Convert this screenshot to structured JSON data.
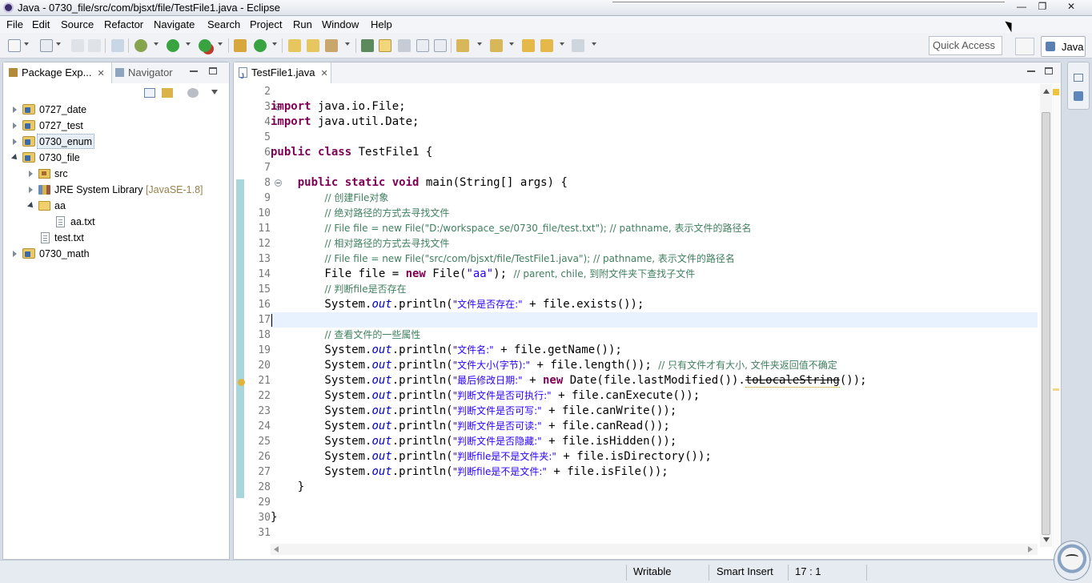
{
  "window": {
    "title": "Java - 0730_file/src/com/bjsxt/file/TestFile1.java - Eclipse",
    "controls": {
      "minimize": "—",
      "maximize": "❐",
      "close": "✕"
    }
  },
  "menubar": [
    "File",
    "Edit",
    "Source",
    "Refactor",
    "Navigate",
    "Search",
    "Project",
    "Run",
    "Window",
    "Help"
  ],
  "toolbar": {
    "quick_access": "Quick Access",
    "perspective": "Java"
  },
  "package_explorer": {
    "tabs": [
      {
        "label": "Package Exp...",
        "icon": "package-explorer-icon",
        "active": true
      },
      {
        "label": "Navigator",
        "icon": "navigator-icon",
        "active": false
      }
    ],
    "tree": [
      {
        "label": "0727_date",
        "type": "project",
        "expanded": false
      },
      {
        "label": "0727_test",
        "type": "project",
        "expanded": false
      },
      {
        "label": "0730_enum",
        "type": "project",
        "expanded": false,
        "selected": true
      },
      {
        "label": "0730_file",
        "type": "project",
        "expanded": true
      },
      {
        "label": "src",
        "type": "source-folder",
        "expanded": false
      },
      {
        "label": "JRE System Library",
        "decoration": "[JavaSE-1.8]",
        "type": "library",
        "expanded": false
      },
      {
        "label": "aa",
        "type": "folder",
        "expanded": true
      },
      {
        "label": "aa.txt",
        "type": "file"
      },
      {
        "label": "test.txt",
        "type": "file"
      },
      {
        "label": "0730_math",
        "type": "project",
        "expanded": false
      }
    ]
  },
  "editor": {
    "tab_label": "TestFile1.java",
    "line_numbers": [
      "2",
      "3",
      "4",
      "5",
      "6",
      "7",
      "8",
      "9",
      "10",
      "11",
      "12",
      "13",
      "14",
      "15",
      "16",
      "17",
      "18",
      "19",
      "20",
      "21",
      "22",
      "23",
      "24",
      "25",
      "26",
      "27",
      "28",
      "29",
      "30",
      "31"
    ],
    "code": [
      {
        "n": "2",
        "t": ""
      },
      {
        "n": "3",
        "t": "import java.io.File;"
      },
      {
        "n": "4",
        "t": "import java.util.Date;"
      },
      {
        "n": "5",
        "t": ""
      },
      {
        "n": "6",
        "t": "public class TestFile1 {"
      },
      {
        "n": "7",
        "t": ""
      },
      {
        "n": "8",
        "t": "    public static void main(String[] args) {"
      },
      {
        "n": "9",
        "t": "        // 创建File对象"
      },
      {
        "n": "10",
        "t": "        // 绝对路径的方式去寻找文件"
      },
      {
        "n": "11",
        "t": "        // File file = new File(\"D:/workspace_se/0730_file/test.txt\"); // pathname, 表示文件的路径名"
      },
      {
        "n": "12",
        "t": "        // 相对路径的方式去寻找文件"
      },
      {
        "n": "13",
        "t": "        // File file = new File(\"src/com/bjsxt/file/TestFile1.java\"); // pathname, 表示文件的路径名"
      },
      {
        "n": "14",
        "t": "        File file = new File(\"aa\"); // parent, chile, 到附文件夹下查找子文件"
      },
      {
        "n": "15",
        "t": "        // 判断file是否存在"
      },
      {
        "n": "16",
        "t": "        System.out.println(\"文件是否存在:\" + file.exists());"
      },
      {
        "n": "17",
        "t": ""
      },
      {
        "n": "18",
        "t": "        // 查看文件的一些属性"
      },
      {
        "n": "19",
        "t": "        System.out.println(\"文件名:\" + file.getName());"
      },
      {
        "n": "20",
        "t": "        System.out.println(\"文件大小(字节):\" + file.length()); // 只有文件才有大小, 文件夹返回值不确定"
      },
      {
        "n": "21",
        "t": "        System.out.println(\"最后修改日期:\" + new Date(file.lastModified()).toLocaleString());"
      },
      {
        "n": "22",
        "t": "        System.out.println(\"判断文件是否可执行:\" + file.canExecute());"
      },
      {
        "n": "23",
        "t": "        System.out.println(\"判断文件是否可写:\" + file.canWrite());"
      },
      {
        "n": "24",
        "t": "        System.out.println(\"判断文件是否可读:\" + file.canRead());"
      },
      {
        "n": "25",
        "t": "        System.out.println(\"判断文件是否隐藏:\" + file.isHidden());"
      },
      {
        "n": "26",
        "t": "        System.out.println(\"判断file是不是文件夹:\" + file.isDirectory());"
      },
      {
        "n": "27",
        "t": "        System.out.println(\"判断file是不是文件:\" + file.isFile());"
      },
      {
        "n": "28",
        "t": "    }"
      },
      {
        "n": "29",
        "t": ""
      },
      {
        "n": "30",
        "t": "}"
      },
      {
        "n": "31",
        "t": ""
      }
    ],
    "current_line": "17"
  },
  "statusbar": {
    "mode": "Writable",
    "insert_mode": "Smart Insert",
    "position": "17 : 1"
  },
  "colors": {
    "keyword": "#7f0055",
    "comment": "#3f7f5f",
    "string": "#2a00ff",
    "static_field": "#0000c0",
    "current_line": "#e8f2fe",
    "fold_bar": "#a9d6dc"
  }
}
